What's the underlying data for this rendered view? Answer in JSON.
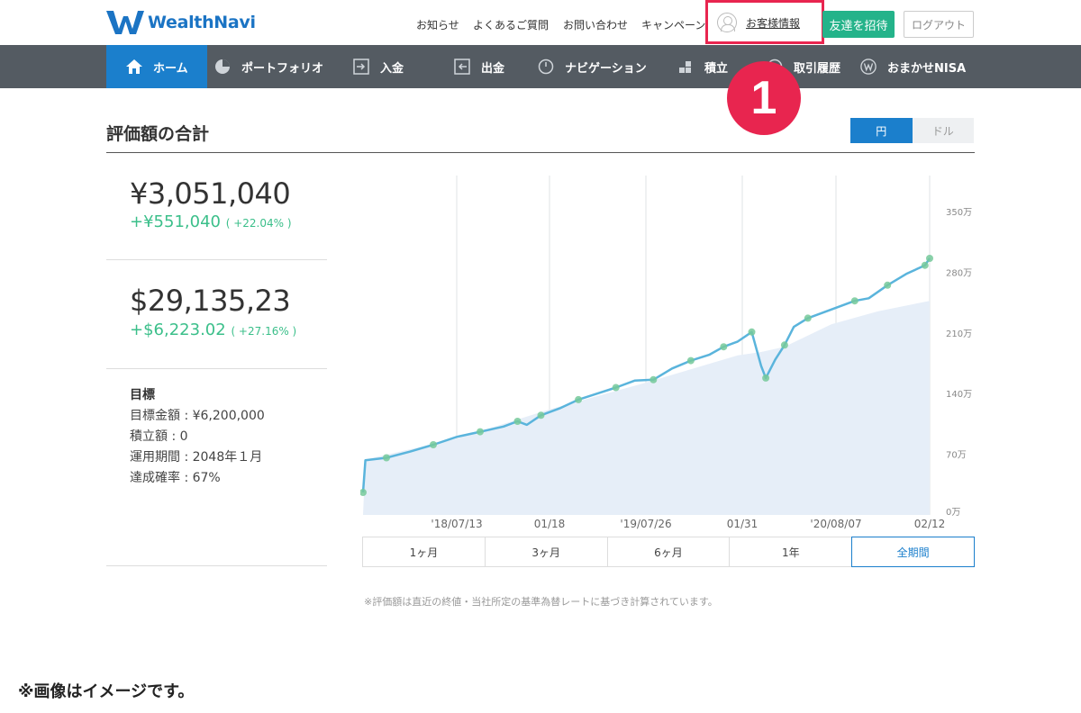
{
  "header": {
    "logo_text": "WealthNavi",
    "links": [
      "お知らせ",
      "よくあるご質問",
      "お問い合わせ",
      "キャンペーン"
    ],
    "account_label": "お客様情報",
    "invite_label": "友達を招待",
    "logout_label": "ログアウト",
    "highlight_color": "#e8254f"
  },
  "nav": {
    "items": [
      {
        "label": "ホーム",
        "icon": "home-icon",
        "active": true
      },
      {
        "label": "ポートフォリオ",
        "icon": "pie-icon",
        "active": false
      },
      {
        "label": "入金",
        "icon": "deposit-icon",
        "active": false
      },
      {
        "label": "出金",
        "icon": "withdraw-icon",
        "active": false
      },
      {
        "label": "ナビゲーション",
        "icon": "gauge-icon",
        "active": false
      },
      {
        "label": "積立",
        "icon": "blocks-icon",
        "active": false
      },
      {
        "label": "取引履歴",
        "icon": "history-icon",
        "active": false
      },
      {
        "label": "おまかせNISA",
        "icon": "nisa-icon",
        "active": false
      }
    ]
  },
  "badge": "1",
  "section": {
    "title": "評価額の合計",
    "currency_toggle": [
      "円",
      "ドル"
    ],
    "selected_currency": "円"
  },
  "summary": {
    "yen_total": "¥3,051,040",
    "yen_gain": "+¥551,040",
    "yen_gain_pct": "( +22.04% )",
    "usd_total": "$29,135,23",
    "usd_gain": "+$6,223.02",
    "usd_gain_pct": "( +27.16% )",
    "gain_color": "#3bbf8a"
  },
  "goal": {
    "title": "目標",
    "amount": "目標金額 : ¥6,200,000",
    "monthly": "積立額 : 0",
    "period": "運用期間 : 2048年１月",
    "probability": "達成確率 : 67%"
  },
  "chart_data": {
    "type": "area",
    "x_tick_labels": [
      "'18/07/13",
      "01/18",
      "'19/07/26",
      "01/31",
      "'20/08/07",
      "02/12"
    ],
    "y_tick_labels": [
      "0万",
      "70万",
      "140万",
      "210万",
      "280万",
      "350万"
    ],
    "ylim": [
      0,
      3500000
    ],
    "series": [
      {
        "color": "#5ab4dc",
        "points": [
          [
            0,
            260000
          ],
          [
            0.005,
            630000
          ],
          [
            0.05,
            660000
          ],
          [
            0.1,
            730000
          ],
          [
            0.15,
            810000
          ],
          [
            0.2,
            900000
          ],
          [
            0.25,
            960000
          ],
          [
            0.3,
            1020000
          ],
          [
            0.33,
            1080000
          ],
          [
            0.35,
            1040000
          ],
          [
            0.38,
            1150000
          ],
          [
            0.42,
            1230000
          ],
          [
            0.46,
            1330000
          ],
          [
            0.5,
            1400000
          ],
          [
            0.54,
            1470000
          ],
          [
            0.58,
            1550000
          ],
          [
            0.62,
            1560000
          ],
          [
            0.66,
            1690000
          ],
          [
            0.7,
            1780000
          ],
          [
            0.74,
            1850000
          ],
          [
            0.77,
            1940000
          ],
          [
            0.8,
            2000000
          ],
          [
            0.83,
            2110000
          ],
          [
            0.85,
            1720000
          ],
          [
            0.86,
            1580000
          ],
          [
            0.88,
            1790000
          ],
          [
            0.9,
            1960000
          ],
          [
            0.92,
            2170000
          ],
          [
            0.95,
            2270000
          ],
          [
            1.0,
            2370000
          ],
          [
            1.05,
            2470000
          ],
          [
            1.08,
            2500000
          ],
          [
            1.12,
            2650000
          ],
          [
            1.16,
            2780000
          ],
          [
            1.2,
            2880000
          ],
          [
            1.21,
            2960000
          ]
        ]
      },
      {
        "color": "#e6eef8",
        "points": [
          [
            0,
            0
          ],
          [
            0.005,
            640000
          ],
          [
            0.2,
            880000
          ],
          [
            0.4,
            1220000
          ],
          [
            0.6,
            1520000
          ],
          [
            0.8,
            1840000
          ],
          [
            0.85,
            1880000
          ],
          [
            0.9,
            1940000
          ],
          [
            1.0,
            2200000
          ],
          [
            1.1,
            2350000
          ],
          [
            1.21,
            2470000
          ]
        ]
      }
    ],
    "marker_color": "#76c99a"
  },
  "periods": [
    "1ヶ月",
    "3ヶ月",
    "6ヶ月",
    "1年",
    "全期間"
  ],
  "selected_period": "全期間",
  "note": "※評価額は直近の終値・当社所定の基準為替レートに基づき計算されています。",
  "caption": "※画像はイメージです。"
}
